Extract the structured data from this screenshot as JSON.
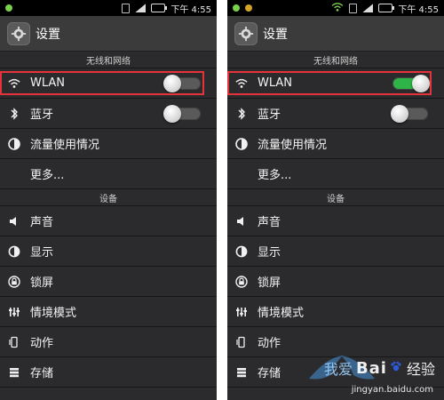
{
  "screen_left": {
    "status": {
      "time": "下午 4:55"
    },
    "app_title": "设置",
    "sections": {
      "wireless": "无线和网络",
      "device": "设备"
    },
    "items": [
      {
        "label": "WLAN",
        "icon": "wifi-icon",
        "toggle": "off",
        "highlight": true
      },
      {
        "label": "蓝牙",
        "icon": "bluetooth-icon",
        "toggle": "off"
      },
      {
        "label": "流量使用情况",
        "icon": "data-usage-icon"
      },
      {
        "label": "更多...",
        "icon": "none"
      }
    ],
    "device_items": [
      {
        "label": "声音",
        "icon": "sound-icon"
      },
      {
        "label": "显示",
        "icon": "display-icon"
      },
      {
        "label": "锁屏",
        "icon": "lock-icon"
      },
      {
        "label": "情境模式",
        "icon": "sliders-icon"
      },
      {
        "label": "动作",
        "icon": "motion-icon"
      },
      {
        "label": "存储",
        "icon": "storage-icon"
      }
    ]
  },
  "screen_right": {
    "status": {
      "time": "下午 4:55"
    },
    "app_title": "设置",
    "sections": {
      "wireless": "无线和网络",
      "device": "设备"
    },
    "items": [
      {
        "label": "WLAN",
        "icon": "wifi-icon",
        "toggle": "on",
        "highlight": true
      },
      {
        "label": "蓝牙",
        "icon": "bluetooth-icon",
        "toggle": "off"
      },
      {
        "label": "流量使用情况",
        "icon": "data-usage-icon"
      },
      {
        "label": "更多...",
        "icon": "none"
      }
    ],
    "device_items": [
      {
        "label": "声音",
        "icon": "sound-icon"
      },
      {
        "label": "显示",
        "icon": "display-icon"
      },
      {
        "label": "锁屏",
        "icon": "lock-icon"
      },
      {
        "label": "情境模式",
        "icon": "sliders-icon"
      },
      {
        "label": "动作",
        "icon": "motion-icon"
      },
      {
        "label": "存储",
        "icon": "storage-icon"
      }
    ]
  },
  "watermark": {
    "brand": "Bai",
    "brand_suffix": "经验",
    "sub": "jingyan.baidu.com",
    "cn_text": "我爱"
  },
  "colors": {
    "background": "#2b2b2d",
    "highlight": "#e5323b",
    "toggle_on": "#2fb447",
    "toggle_off": "#5a5a5a"
  }
}
